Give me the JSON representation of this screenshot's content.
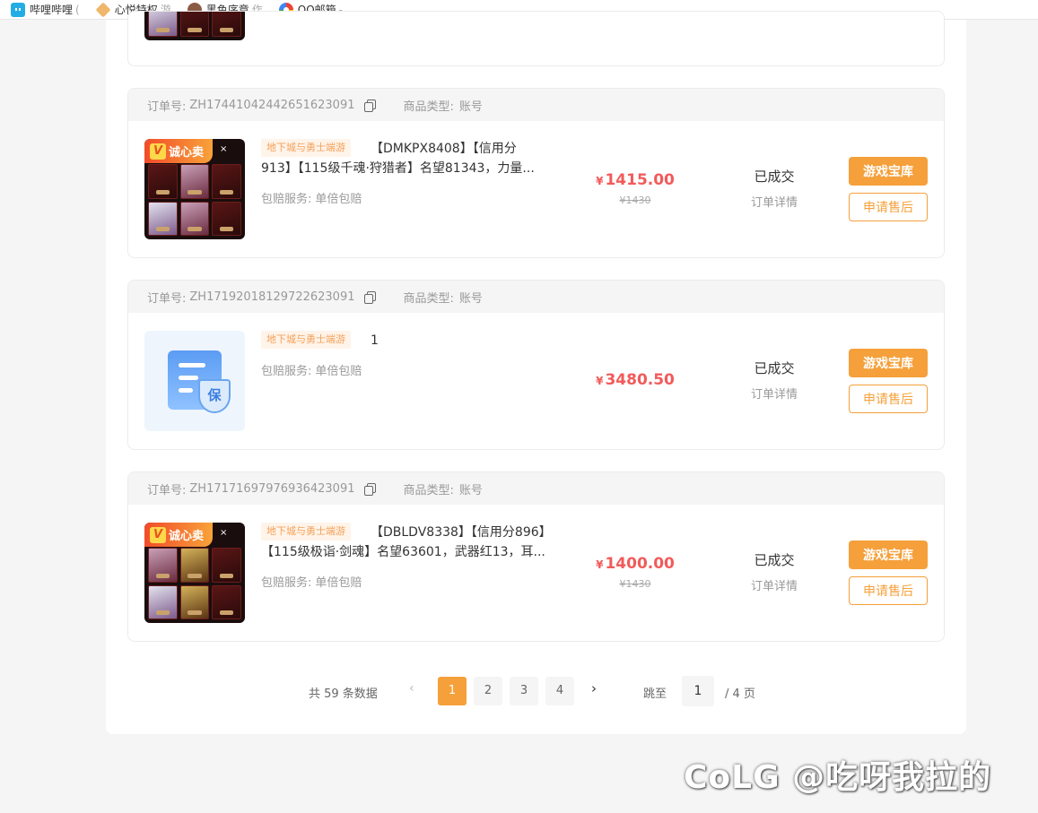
{
  "bookmarks": [
    {
      "label": "哔哩哔哩",
      "icon": "bilibili-icon",
      "extra": "("
    },
    {
      "label": "心悦特权",
      "icon": "xinyue-icon",
      "extra": "游"
    },
    {
      "label": "黑色序章",
      "icon": "book-icon",
      "extra": "作"
    },
    {
      "label": "QQ邮箱",
      "icon": "qq-mail-icon",
      "extra": "-"
    }
  ],
  "labels": {
    "order_no": "订单号:",
    "goods_type": "商品类型:",
    "type_value": "账号",
    "service": "包赔服务:",
    "service_value": "单倍包赔",
    "badge": "诚心卖",
    "shield_char": "保",
    "status": "已成交",
    "detail": "订单详情",
    "btn_vault": "游戏宝库",
    "btn_aftersale": "申请售后",
    "currency": "¥"
  },
  "orders": [
    {
      "order_no": "ZH17441042442651623091",
      "tag": "地下城与勇士端游",
      "title_line1": "【DMKPX8408】【信用分",
      "title_line2": "913】【115级千魂·狩猎者】名望81343，力量...",
      "price": "1415.00",
      "orig_price": "¥1430"
    },
    {
      "order_no": "ZH17192018129722623091",
      "tag": "地下城与勇士端游",
      "title_line1": "1",
      "title_line2": "",
      "price": "3480.50",
      "orig_price": ""
    },
    {
      "order_no": "ZH17171697976936423091",
      "tag": "地下城与勇士端游",
      "title_line1": "【DBLDV8338】【信用分896】",
      "title_line2": "【115级极诣·剑魂】名望63601，武器红13，耳...",
      "price": "1400.00",
      "orig_price": "¥1430"
    }
  ],
  "pagination": {
    "total": "共 59 条数据",
    "prev": "‹",
    "pages": [
      "1",
      "2",
      "3",
      "4"
    ],
    "current": "1",
    "next": "›",
    "jump_label": "跳至",
    "jump_value": "1",
    "total_pages": "/ 4 页"
  },
  "watermark": "CoLG @吃呀我拉的",
  "colors": {
    "accent": "#f5a03a",
    "price": "#f25a5a"
  }
}
